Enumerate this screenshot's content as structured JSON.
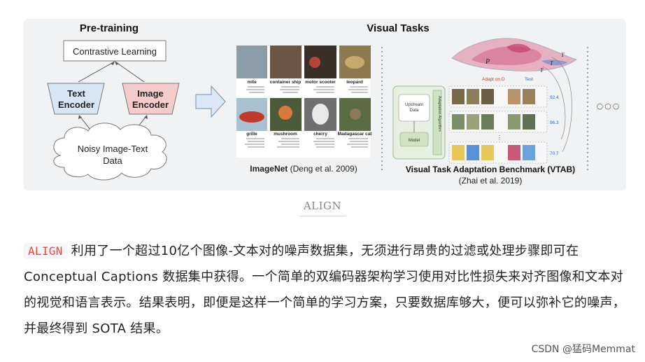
{
  "figure": {
    "pretraining": {
      "title": "Pre-training",
      "contrastive_learning": "Contrastive Learning",
      "text_encoder": [
        "Text",
        "Encoder"
      ],
      "image_encoder": [
        "Image",
        "Encoder"
      ],
      "data_cloud": [
        "Noisy Image-Text",
        "Data"
      ]
    },
    "visual_tasks": {
      "title": "Visual Tasks",
      "imagenet_labels_row1": [
        "mite",
        "container ship",
        "motor scooter",
        "leopard"
      ],
      "imagenet_labels_row2": [
        "grille",
        "mushroom",
        "cherry",
        "Madagascar cat"
      ],
      "imagenet_caption_bold": "ImageNet",
      "imagenet_caption_rest": " (Deng et al. 2009)",
      "vtab_caption": "Visual Task Adaptation Benchmark (VTAB)",
      "vtab_citation": "(Zhai et al. 2019)",
      "vtab_adapt_label": "Adapt on D",
      "vtab_test_label": "Test",
      "vtab_upstream": [
        "Upstream",
        "Data"
      ],
      "vtab_model": "Model",
      "vtab_algorithm": "Adaptation Algorithm",
      "vtab_scores": [
        "92.4",
        "96.3",
        "70.7"
      ],
      "vtab_pt": "P",
      "vtab_taus": [
        "T",
        "T",
        "T"
      ],
      "more_dots": "○○○"
    }
  },
  "caption": "ALIGN",
  "paragraph": {
    "code": "ALIGN",
    "text": "利用了一个超过10亿个图像-文本对的噪声数据集，无须进行昂贵的过滤或处理步骤即可在 Conceptual Captions 数据集中获得。一个简单的双编码器架构学习使用对比性损失来对齐图像和文本对的视觉和语言表示。结果表明，即便是这样一个简单的学习方案，只要数据库够大，便可以弥补它的噪声，并最终得到 SOTA 结果。"
  },
  "watermark": "CSDN @猛码Memmat",
  "colors": {
    "text_encoder_fill": "#d6e6f5",
    "image_encoder_fill": "#f4cccc",
    "arrow_fill": "#dce8f5",
    "inline_code": "#e9463f"
  }
}
